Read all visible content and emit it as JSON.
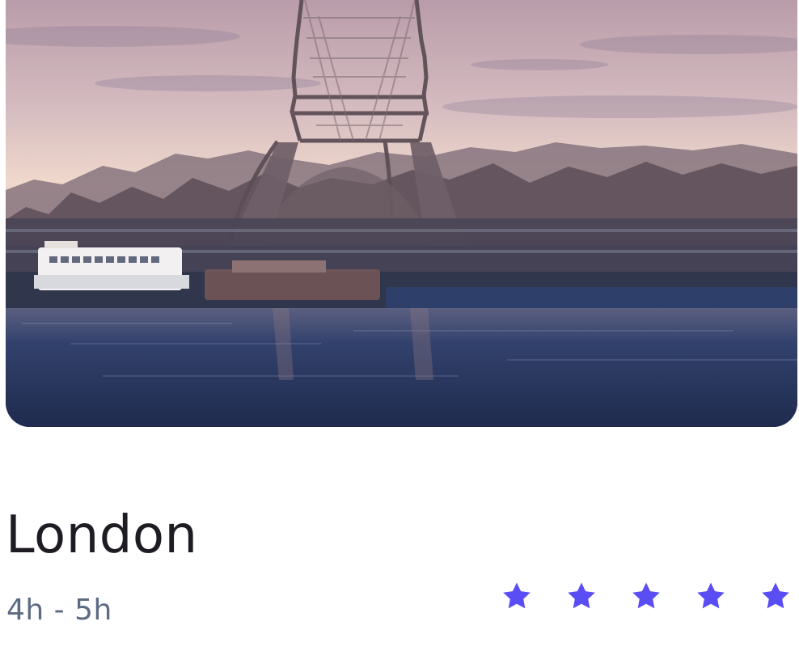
{
  "destination": {
    "name": "London",
    "duration": "4h - 5h",
    "rating": 5,
    "rating_max": 5
  },
  "hero_image": {
    "subject": "eiffel-tower-over-river",
    "icon": "photo-image"
  },
  "colors": {
    "star": "#5b4df4",
    "title": "#1f1b22",
    "subtitle": "#5d6b82",
    "sky_top": "#c7aeb7",
    "sky_bottom": "#efd4c6",
    "water": "#24315a"
  }
}
